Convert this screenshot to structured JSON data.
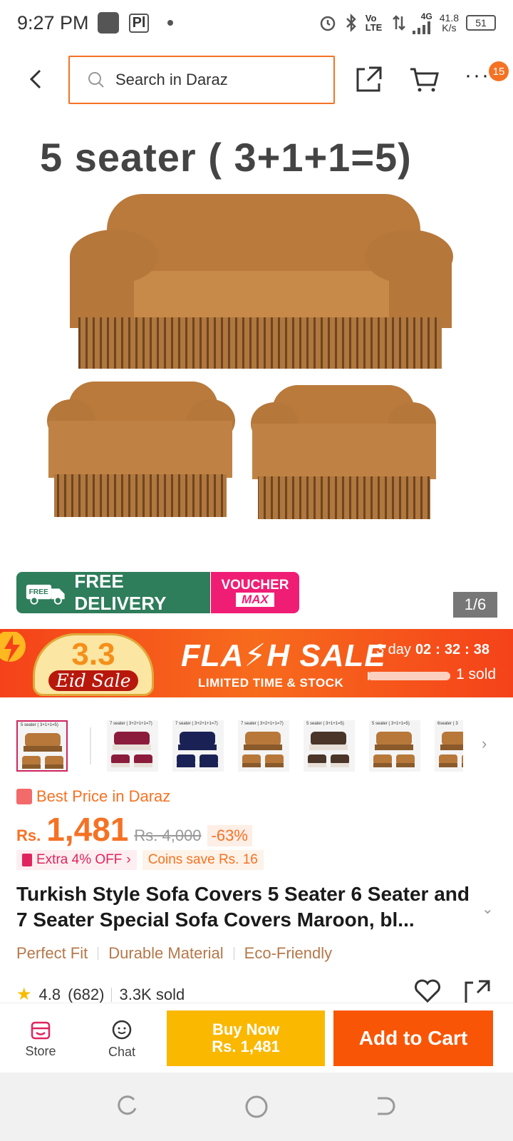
{
  "status_bar": {
    "time": "9:27 PM",
    "net_speed": "41.8",
    "net_unit": "K/s",
    "network": "4G",
    "volte": "Vo LTE",
    "battery": "51"
  },
  "header": {
    "search_placeholder": "Search in Daraz",
    "notification_count": "15"
  },
  "hero": {
    "caption": "5 seater ( 3+1+1=5)",
    "image_index": "1/6"
  },
  "badges": {
    "free_label": "FREE",
    "free_delivery": "FREE DELIVERY",
    "voucher_top": "VOUCHER",
    "voucher_bottom": "MAX"
  },
  "flash_sale": {
    "eid_number": "3.3",
    "eid_label": "Eid Sale",
    "title": "FLA⚡H SALE",
    "subtitle": "LIMITED TIME & STOCK",
    "days": "3 day",
    "hours": "02",
    "minutes": "32",
    "seconds": "38",
    "sold": "1 sold",
    "sold_fraction": 0.02
  },
  "thumbnails": [
    {
      "label": "5 seater ( 3+1+1=5)",
      "colors": [
        "#b7783a",
        "#8a5a2b"
      ]
    },
    {
      "label": "7 seater ( 3+2+1+1=7)",
      "colors": [
        "#8c1c3c",
        "#e8e0d8"
      ]
    },
    {
      "label": "7 seater ( 3+2+1+1=7)",
      "colors": [
        "#1a2255",
        "#1a2255"
      ]
    },
    {
      "label": "7 seater ( 3+2+1+1=7)",
      "colors": [
        "#b7783a",
        "#8a5a2b"
      ]
    },
    {
      "label": "5 seater ( 3+1+1=5)",
      "colors": [
        "#4a3528",
        "#e8e0d8"
      ]
    },
    {
      "label": "5 seater ( 3+1+1=5)",
      "colors": [
        "#b7783a",
        "#8a5a2b"
      ]
    },
    {
      "label": "6seater ( 3",
      "colors": [
        "#b7783a",
        "#8a5a2b"
      ]
    }
  ],
  "price": {
    "best_price": "Best Price in Daraz",
    "currency": "Rs.",
    "value": "1,481",
    "original": "Rs. 4,000",
    "discount": "-63%",
    "extra_off": "Extra 4% OFF",
    "coins": "Coins save Rs. 16"
  },
  "product": {
    "title": "Turkish Style Sofa Covers 5 Seater 6 Seater and 7 Seater Special Sofa Covers Maroon, bl...",
    "features": [
      "Perfect Fit",
      "Durable Material",
      "Eco-Friendly"
    ],
    "rating": "4.8",
    "reviews": "(682)",
    "sold": "3.3K sold"
  },
  "bottom_bar": {
    "store": "Store",
    "chat": "Chat",
    "buy_now": "Buy Now",
    "buy_now_price": "Rs. 1,481",
    "add_to_cart": "Add to Cart"
  },
  "colors": {
    "accent": "#f57224",
    "buy_now": "#fab800",
    "add_to_cart": "#f85606"
  }
}
